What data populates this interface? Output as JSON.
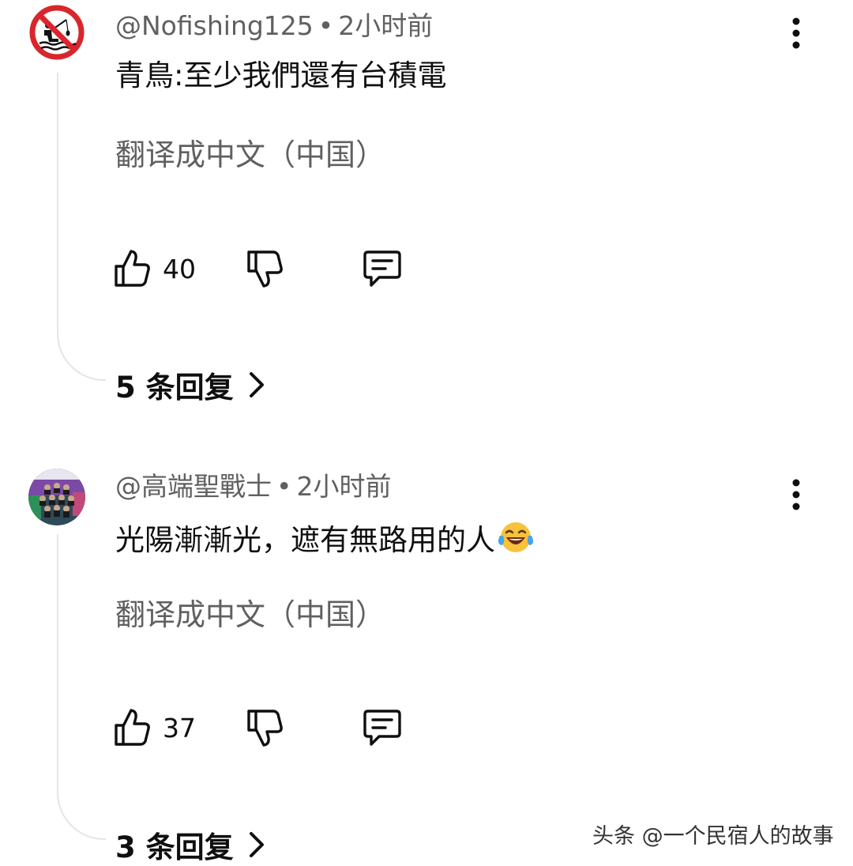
{
  "comments": [
    {
      "handle": "@Nofishing125",
      "separator": "•",
      "time": "2小时前",
      "text": "青鳥:至少我們還有台積電",
      "translate_label": "翻译成中文（中国）",
      "like_count": "40",
      "replies_label": "5 条回复",
      "avatar_icon": "no-fishing-sign-icon"
    },
    {
      "handle": "@高端聖戰士",
      "separator": "•",
      "time": "2小时前",
      "text": "光陽漸漸光，遮有無路用的人",
      "emoji": "face-with-tears-of-joy",
      "translate_label": "翻译成中文（中国）",
      "like_count": "37",
      "replies_label": "3 条回复",
      "avatar_icon": "group-poster-avatar"
    }
  ],
  "watermark": "头条 @一个民宿人的故事",
  "colors": {
    "primary_text": "#0f0f0f",
    "secondary_text": "#606060",
    "thread_line": "#e5e5e5",
    "sign_red": "#d8262d"
  }
}
